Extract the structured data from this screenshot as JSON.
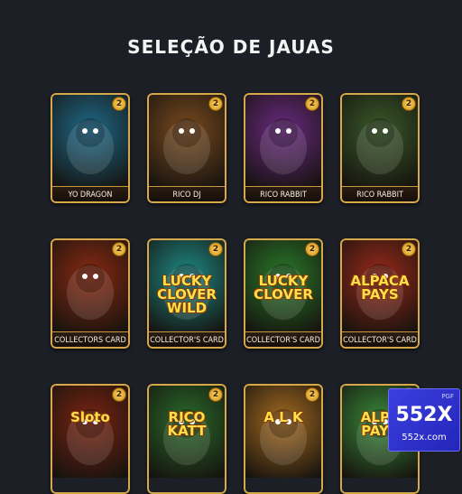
{
  "page": {
    "title": "SELEÇÃO DE JAUAS"
  },
  "cards": [
    {
      "label": "YO DRAGON",
      "badge": "2",
      "art_icon": "dragon-art",
      "bg": "#1e6a8a"
    },
    {
      "label": "RICO DJ",
      "badge": "2",
      "art_icon": "rabbit-dj-art",
      "bg": "#7a4a1e"
    },
    {
      "label": "RICO RABBIT",
      "badge": "2",
      "art_icon": "gorilla-purple-art",
      "bg": "#6a2a80"
    },
    {
      "label": "RICO RABBIT",
      "badge": "2",
      "art_icon": "gorilla-gold-art",
      "bg": "#3a5a2a"
    },
    {
      "label": "COLLECTORS CARD",
      "badge": "2",
      "art_icon": "pirate-art",
      "bg": "#8a2a12"
    },
    {
      "label": "COLLECTOR'S CARD",
      "badge": "2",
      "art_icon": "lucky-clover-wild-art",
      "bg": "#1e8a86",
      "logo": "LUCKY CLOVER WILD"
    },
    {
      "label": "COLLECTOR'S CARD",
      "badge": "2",
      "art_icon": "lucky-clover-art",
      "bg": "#2a7a2a",
      "logo": "LUCKY CLOVER"
    },
    {
      "label": "COLLECTOR'S CARD",
      "badge": "2",
      "art_icon": "alpaca-pays-art",
      "bg": "#9a2a1a",
      "logo": "ALPACA PAYS"
    },
    {
      "label": "",
      "badge": "2",
      "art_icon": "slots-art",
      "bg": "#7a2412",
      "logo": "Sloto"
    },
    {
      "label": "",
      "badge": "2",
      "art_icon": "rico-katt-art",
      "bg": "#2a6a2a",
      "logo": "RICO KATT"
    },
    {
      "label": "",
      "badge": "2",
      "art_icon": "panda-art",
      "bg": "#a46a20",
      "logo": "A L K"
    },
    {
      "label": "",
      "badge": "2",
      "art_icon": "alpaca-pays-art-2",
      "bg": "#3a8a3a",
      "logo": "ALPA PAYS"
    }
  ],
  "promo": {
    "brand": "552X",
    "site": "552x.com",
    "tag": "PGF"
  }
}
